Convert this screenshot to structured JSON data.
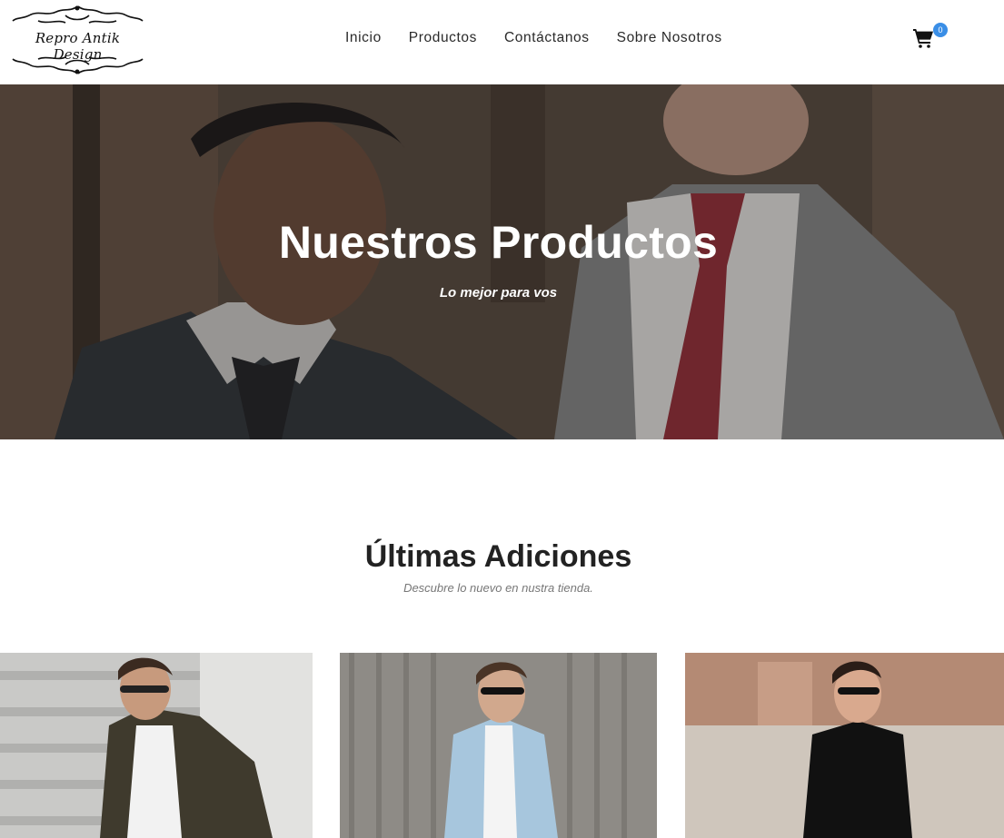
{
  "header": {
    "logo_text": "Repro Antik Design",
    "nav": [
      "Inicio",
      "Productos",
      "Contáctanos",
      "Sobre Nosotros"
    ],
    "cart_icon": "shopping-cart-icon",
    "cart_count": "0",
    "badge_color": "#3a8ee6"
  },
  "hero": {
    "title": "Nuestros Productos",
    "subtitle": "Lo mejor para vos"
  },
  "section": {
    "title": "Últimas Adiciones",
    "subtitle": "Descubre lo nuevo en nustra tienda."
  },
  "products": [
    {
      "image": "man-camouflage-jacket-photo"
    },
    {
      "image": "man-denim-jacket-photo"
    },
    {
      "image": "man-black-sweater-photo"
    }
  ]
}
